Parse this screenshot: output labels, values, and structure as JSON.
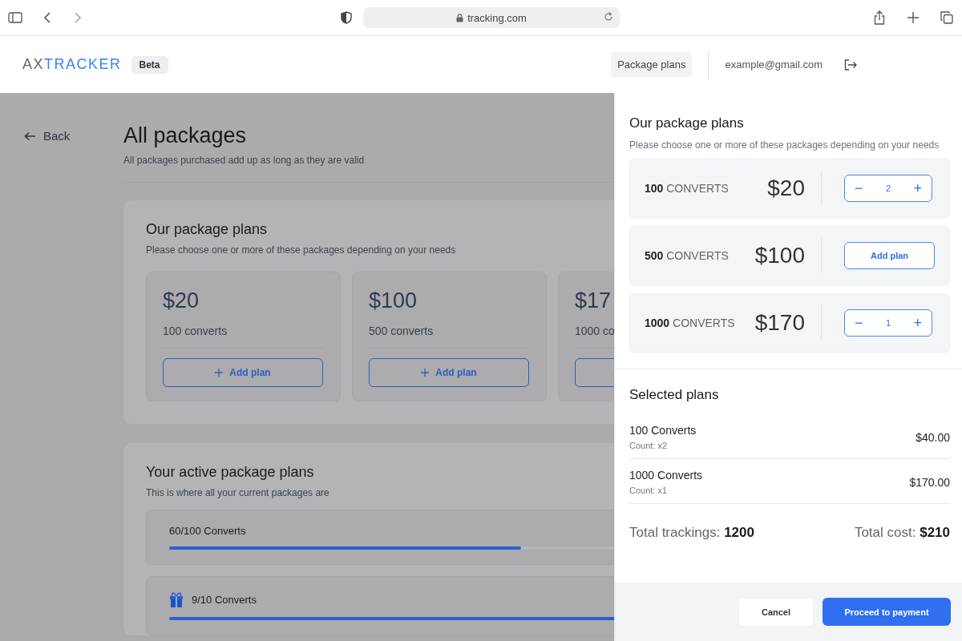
{
  "browser": {
    "url": "tracking.com"
  },
  "header": {
    "logo": {
      "part_1": "AX",
      "part_2": "TRACKER"
    },
    "badge": "Beta",
    "nav_link": "Package plans",
    "email": "example@gmail.com"
  },
  "page": {
    "back": "Back",
    "title": "All packages",
    "subtitle": "All packages purchased add up as long as they are valid",
    "plans_card": {
      "title": "Our package plans",
      "subtitle": "Please choose one or more of these packages depending on your needs",
      "plans": [
        {
          "price": "$20",
          "converts": "100 converts",
          "button": "Add plan"
        },
        {
          "price": "$100",
          "converts": "500 converts",
          "button": "Add plan"
        },
        {
          "price": "$17",
          "converts": "1000 co"
        }
      ]
    },
    "active_card": {
      "title": "Your active package plans",
      "subtitle": "This is where all your current packages are",
      "rows": [
        {
          "label": "60/100 Converts",
          "level": 0.6,
          "gift": false
        },
        {
          "label": "9/10 Converts",
          "level": 0.9,
          "gift": true
        }
      ]
    }
  },
  "panel": {
    "title": "Our package plans",
    "subtitle": "Please choose one or more of these packages depending on your needs",
    "plans": [
      {
        "kind": "stepper",
        "amount": "100",
        "unit": "CONVERTS",
        "price": "$20",
        "count": "2",
        "minus": "−",
        "plus": "+"
      },
      {
        "kind": "add",
        "amount": "500",
        "unit": "CONVERTS",
        "price": "$100",
        "button": "Add plan"
      },
      {
        "kind": "stepper",
        "amount": "1000",
        "unit": "CONVERTS",
        "price": "$170",
        "count": "1",
        "minus": "−",
        "plus": "+"
      }
    ],
    "selected_title": "Selected plans",
    "selected": [
      {
        "name": "100 Converts",
        "count": "Count: x2",
        "total": "$40.00"
      },
      {
        "name": "1000 Converts",
        "count": "Count: x1",
        "total": "$170.00"
      }
    ],
    "trackings_label": "Total trackings:",
    "trackings_value": "1200",
    "cost_label": "Total cost:",
    "cost_value": "$210",
    "cancel": "Cancel",
    "proceed": "Proceed to payment"
  }
}
